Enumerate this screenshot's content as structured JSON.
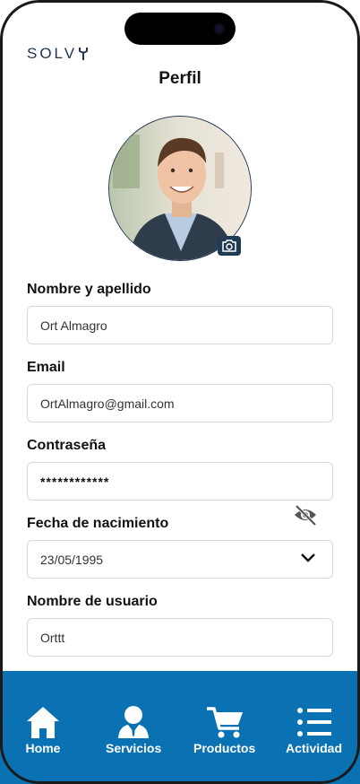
{
  "app": {
    "logo_text": "SOLV"
  },
  "header": {
    "title": "Perfil"
  },
  "profile": {
    "avatar_icon": "user-photo",
    "camera_icon": "camera-icon"
  },
  "form": {
    "name_label": "Nombre y apellido",
    "name_value": "Ort Almagro",
    "email_label": "Email",
    "email_value": "OrtAlmagro@gmail.com",
    "password_label": "Contraseña",
    "password_value": "************",
    "birthdate_label": "Fecha de nacimiento",
    "birthdate_value": "23/05/1995",
    "username_label": "Nombre de usuario",
    "username_value": "Orttt"
  },
  "nav": {
    "items": [
      {
        "label": "Home",
        "icon": "home-icon"
      },
      {
        "label": "Servicios",
        "icon": "person-icon"
      },
      {
        "label": "Productos",
        "icon": "cart-icon"
      },
      {
        "label": "Actividad",
        "icon": "list-icon"
      }
    ]
  },
  "colors": {
    "nav_bg": "#0a72b3",
    "brand": "#1f3450"
  }
}
